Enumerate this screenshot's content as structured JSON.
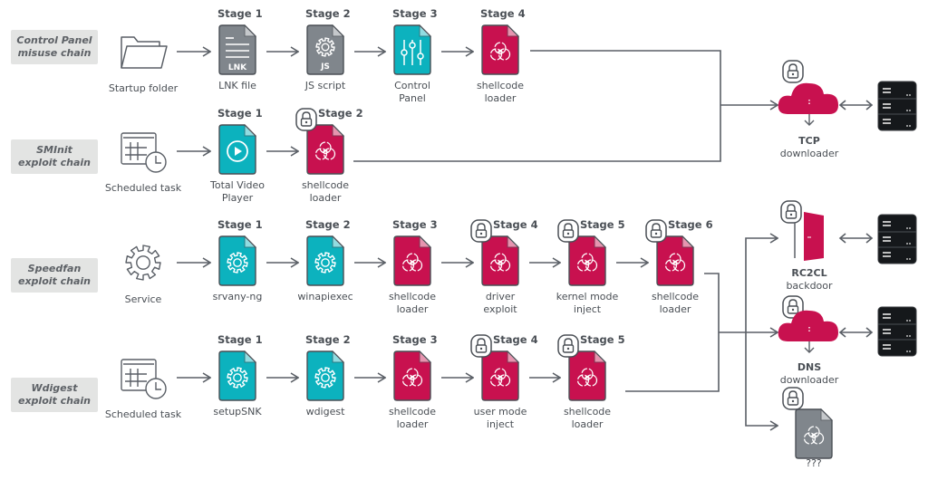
{
  "colors": {
    "stroke": "#5a5f66",
    "gray_file": "#80868c",
    "teal_file": "#0cb2be",
    "crimson_file": "#c8114f",
    "server": "#15181b",
    "label_bg": "#e3e4e3"
  },
  "chains": [
    {
      "label_line1": "Control Panel",
      "label_line2": "misuse chain",
      "origin": {
        "icon": "folder-icon",
        "caption": "Startup folder"
      },
      "stages": [
        {
          "stage": "Stage 1",
          "icon": "lnk-file-icon",
          "color": "gray",
          "caption1": "LNK file",
          "caption2": "",
          "locked": false,
          "badge": "LNK"
        },
        {
          "stage": "Stage 2",
          "icon": "js-script-icon",
          "color": "gray",
          "caption1": "JS script",
          "caption2": "",
          "locked": false,
          "badge": "JS"
        },
        {
          "stage": "Stage 3",
          "icon": "control-panel-icon",
          "color": "teal",
          "caption1": "Control",
          "caption2": "Panel",
          "locked": false
        },
        {
          "stage": "Stage 4",
          "icon": "biohazard-file-icon",
          "color": "crimson",
          "caption1": "shellcode",
          "caption2": "loader",
          "locked": false
        }
      ]
    },
    {
      "label_line1": "SMInit",
      "label_line2": "exploit chain",
      "origin": {
        "icon": "scheduled-task-icon",
        "caption": "Scheduled task"
      },
      "stages": [
        {
          "stage": "Stage 1",
          "icon": "video-player-icon",
          "color": "teal",
          "caption1": "Total Video",
          "caption2": "Player",
          "locked": false
        },
        {
          "stage": "Stage 2",
          "icon": "biohazard-file-icon",
          "color": "crimson",
          "caption1": "shellcode",
          "caption2": "loader",
          "locked": true
        }
      ]
    },
    {
      "label_line1": "Speedfan",
      "label_line2": "exploit chain",
      "origin": {
        "icon": "service-gear-icon",
        "caption": "Service"
      },
      "stages": [
        {
          "stage": "Stage 1",
          "icon": "gear-file-icon",
          "color": "teal",
          "caption1": "srvany-ng",
          "caption2": "",
          "locked": false
        },
        {
          "stage": "Stage 2",
          "icon": "gear-file-icon",
          "color": "teal",
          "caption1": "winapiexec",
          "caption2": "",
          "locked": false
        },
        {
          "stage": "Stage 3",
          "icon": "biohazard-file-icon",
          "color": "crimson",
          "caption1": "shellcode",
          "caption2": "loader",
          "locked": false
        },
        {
          "stage": "Stage 4",
          "icon": "biohazard-file-icon",
          "color": "crimson",
          "caption1": "driver",
          "caption2": "exploit",
          "locked": true
        },
        {
          "stage": "Stage 5",
          "icon": "biohazard-file-icon",
          "color": "crimson",
          "caption1": "kernel mode",
          "caption2": "inject",
          "locked": true
        },
        {
          "stage": "Stage 6",
          "icon": "biohazard-file-icon",
          "color": "crimson",
          "caption1": "shellcode",
          "caption2": "loader",
          "locked": true
        }
      ]
    },
    {
      "label_line1": "Wdigest",
      "label_line2": "exploit chain",
      "origin": {
        "icon": "scheduled-task-icon",
        "caption": "Scheduled task"
      },
      "stages": [
        {
          "stage": "Stage 1",
          "icon": "gear-file-icon",
          "color": "teal",
          "caption1": "setupSNK",
          "caption2": "",
          "locked": false
        },
        {
          "stage": "Stage 2",
          "icon": "gear-file-icon",
          "color": "teal",
          "caption1": "wdigest",
          "caption2": "",
          "locked": false
        },
        {
          "stage": "Stage 3",
          "icon": "biohazard-file-icon",
          "color": "crimson",
          "caption1": "shellcode",
          "caption2": "loader",
          "locked": false
        },
        {
          "stage": "Stage 4",
          "icon": "biohazard-file-icon",
          "color": "crimson",
          "caption1": "user mode",
          "caption2": "inject",
          "locked": true
        },
        {
          "stage": "Stage 5",
          "icon": "biohazard-file-icon",
          "color": "crimson",
          "caption1": "shellcode",
          "caption2": "loader",
          "locked": true
        }
      ]
    }
  ],
  "payloads": [
    {
      "name": "TCP",
      "desc": "downloader",
      "icon": "cloud-downloader-icon",
      "locked": true,
      "server": true
    },
    {
      "name": "RC2CL",
      "desc": "backdoor",
      "icon": "door-backdoor-icon",
      "locked": true,
      "server": true
    },
    {
      "name": "DNS",
      "desc": "downloader",
      "icon": "cloud-downloader-icon",
      "locked": true,
      "server": true
    },
    {
      "name": "",
      "desc": "???",
      "icon": "unknown-biohazard-file-icon",
      "locked": true,
      "server": false
    }
  ]
}
